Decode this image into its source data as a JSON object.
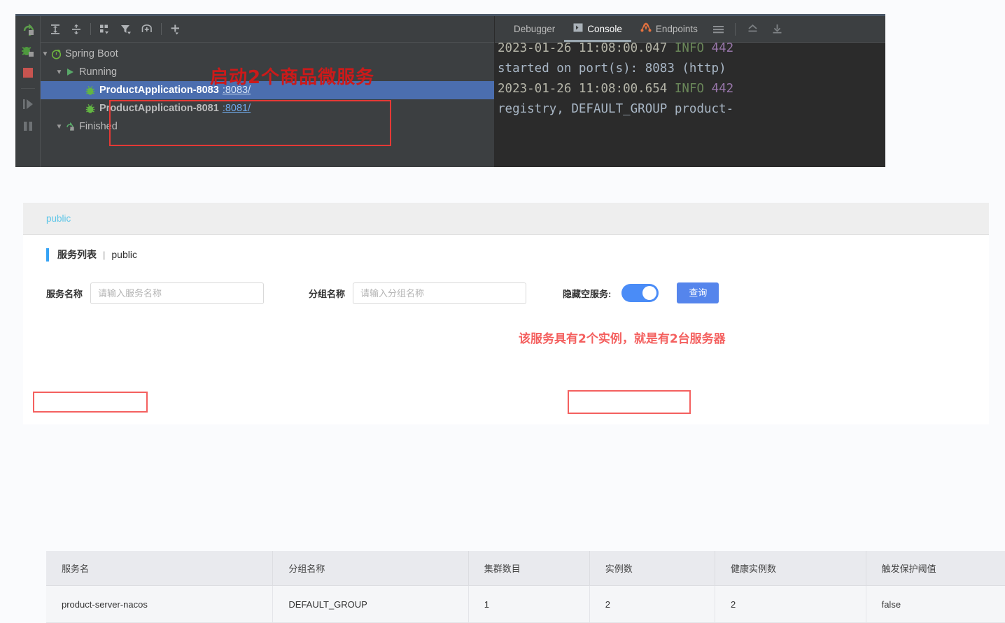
{
  "ide": {
    "gutter_icons": [
      "rerun-icon",
      "debug-icon",
      "stop-icon",
      "resume-icon",
      "pause-icon"
    ],
    "toolbar_icons": [
      "expand-all-icon",
      "collapse-all-icon",
      "group-by-icon",
      "filter-icon",
      "show-inline-icon",
      "add-icon"
    ],
    "tree": {
      "root_label": "Spring Boot",
      "running_label": "Running",
      "finished_label": "Finished",
      "apps": [
        {
          "name": "ProductApplication-8083",
          "port": ":8083/",
          "selected": true
        },
        {
          "name": "ProductApplication-8081",
          "port": ":8081/",
          "selected": false
        }
      ]
    },
    "console_tabs": [
      {
        "label": "Debugger",
        "icon": "none",
        "active": false
      },
      {
        "label": "Console",
        "icon": "console-icon",
        "active": true
      },
      {
        "label": "Endpoints",
        "icon": "endpoints-icon",
        "active": false
      }
    ],
    "console_right_icons": [
      "menu-icon",
      "soft-wrap-icon",
      "scroll-to-end-icon"
    ],
    "console_lines": [
      {
        "ts": "2023-01-26 11:08:00.047",
        "lvl": "INFO",
        "pid": "442",
        "clipped": true
      },
      {
        "txt": "started on port(s): 8083 (http)"
      },
      {
        "ts": "2023-01-26 11:08:00.654",
        "lvl": "INFO",
        "pid": "442"
      },
      {
        "txt": "registry, DEFAULT_GROUP product-"
      }
    ],
    "annotation": "启动2个商品微服务"
  },
  "nacos": {
    "namespace": "public",
    "title": "服务列表",
    "title_sep": "|",
    "title_namespace": "public",
    "filters": {
      "service_label": "服务名称",
      "service_placeholder": "请输入服务名称",
      "service_value": "",
      "group_label": "分组名称",
      "group_placeholder": "请输入分组名称",
      "group_value": "",
      "hide_empty_label": "隐藏空服务:",
      "hide_empty_on": true,
      "query_button": "查询"
    },
    "annotation": "该服务具有2个实例，就是有2台服务器",
    "table": {
      "columns": [
        "服务名",
        "分组名称",
        "集群数目",
        "实例数",
        "健康实例数",
        "触发保护阈值"
      ],
      "rows": [
        [
          "product-server-nacos",
          "DEFAULT_GROUP",
          "1",
          "2",
          "2",
          "false"
        ]
      ]
    }
  },
  "colors": {
    "ide_bg": "#3c3f41",
    "console_bg": "#2b2b2b",
    "selection_blue": "#4b6eaf",
    "annotation_red": "#cc1a1a",
    "annotation_pink": "#f4605f",
    "accent_blue": "#36a3f5",
    "switch_on": "#4a8cf7",
    "button_blue": "#5585ec"
  }
}
